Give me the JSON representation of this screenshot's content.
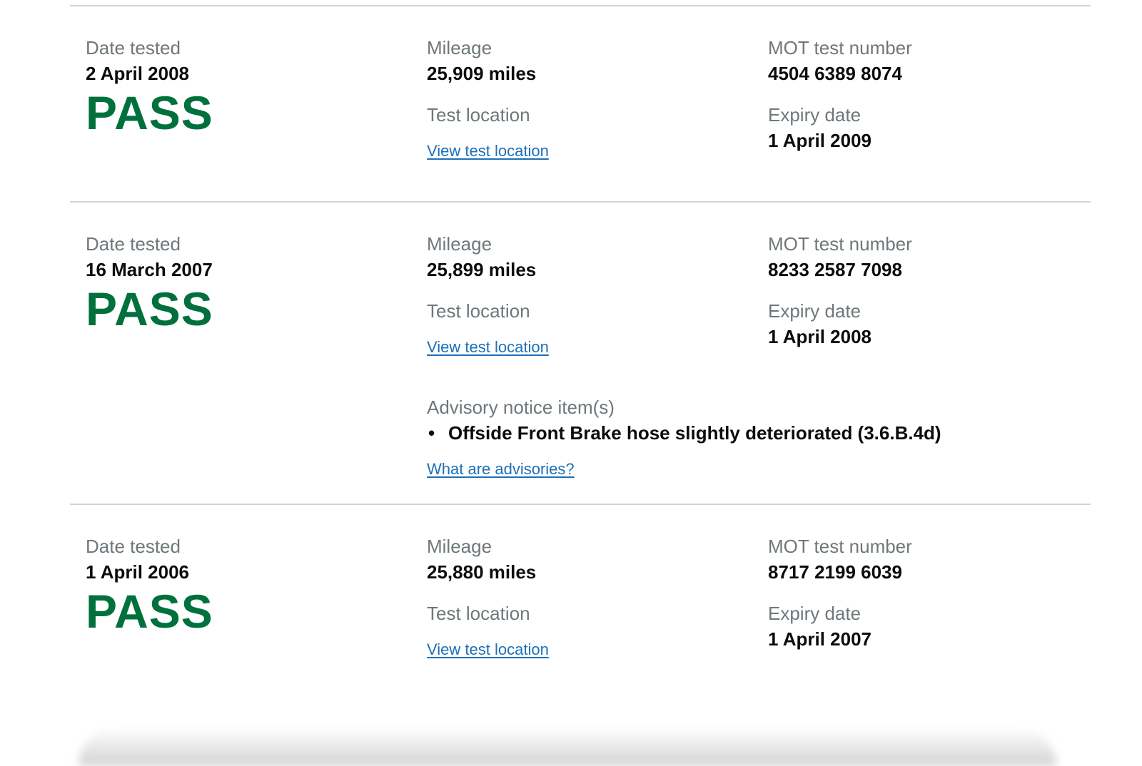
{
  "labels": {
    "date_tested": "Date tested",
    "mileage": "Mileage",
    "mot_test_number": "MOT test number",
    "test_location": "Test location",
    "expiry_date": "Expiry date",
    "view_test_location": "View test location",
    "advisory_notice_items": "Advisory notice item(s)",
    "what_are_advisories": "What are advisories?"
  },
  "colors": {
    "pass_green": "#00703c",
    "link_blue": "#1d70b8",
    "label_grey": "#6f777b",
    "divider": "#d3d3d3"
  },
  "records": [
    {
      "date_tested": "2 April 2008",
      "result": "PASS",
      "mileage": "25,909 miles",
      "mot_test_number": "4504 6389 8074",
      "expiry_date": "1 April 2009"
    },
    {
      "date_tested": "16 March 2007",
      "result": "PASS",
      "mileage": "25,899 miles",
      "mot_test_number": "8233 2587 7098",
      "expiry_date": "1 April 2008",
      "advisories": [
        "Offside Front Brake hose slightly deteriorated (3.6.B.4d)"
      ]
    },
    {
      "date_tested": "1 April 2006",
      "result": "PASS",
      "mileage": "25,880 miles",
      "mot_test_number": "8717 2199 6039",
      "expiry_date": "1 April 2007"
    }
  ]
}
